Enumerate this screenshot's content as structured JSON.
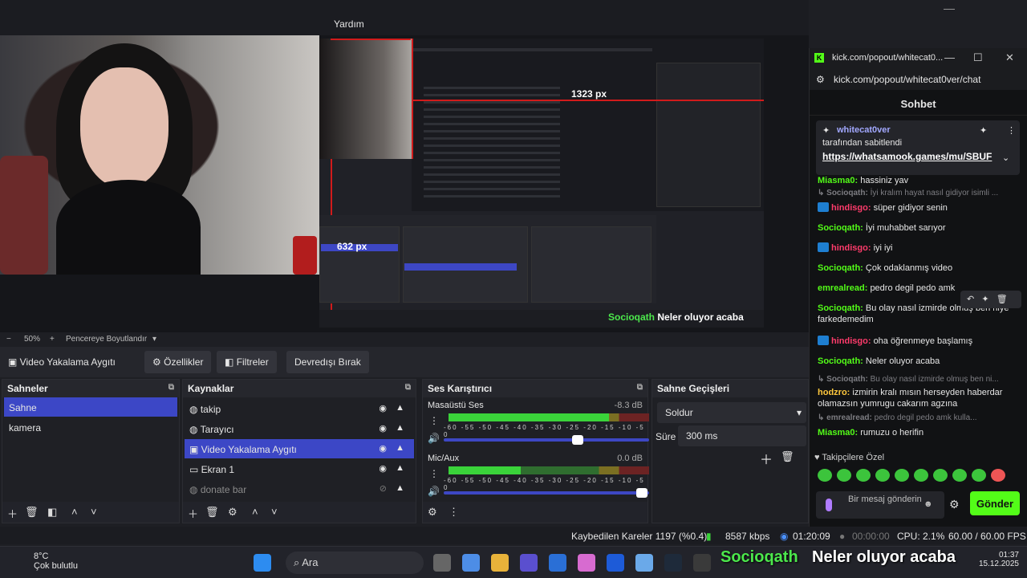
{
  "menubar": {
    "help": "Yardım"
  },
  "mirror": {
    "width_label": "1323 px",
    "height_label": "632 px",
    "overlay_name": "Socioqath",
    "overlay_msg": "Neler oluyor acaba"
  },
  "zoom": {
    "minus": "−",
    "value": "50%",
    "plus": "+",
    "fit_label": "Pencereye Boyutlandır"
  },
  "source_toolbar": {
    "source_name": "Video Yakalama Aygıtı",
    "properties": "Özellikler",
    "filters": "Filtreler",
    "deactivate": "Devredışı Bırak"
  },
  "scenes": {
    "title": "Sahneler",
    "items": [
      "Sahne",
      "kamera"
    ]
  },
  "sources": {
    "title": "Kaynaklar",
    "items": [
      "takip",
      "Tarayıcı",
      "Video Yakalama Aygıtı",
      "Ekran 1",
      "donate bar"
    ]
  },
  "mixer": {
    "title": "Ses Karıştırıcı",
    "channels": [
      {
        "name": "Masaüstü Ses",
        "db": "-8.3 dB",
        "level": 0.8
      },
      {
        "name": "Mic/Aux",
        "db": "0.0 dB",
        "level": 0.36
      }
    ],
    "ticks": "-60 -55 -50 -45 -40 -35 -30 -25 -20 -15 -10 -5 0"
  },
  "transitions": {
    "title": "Sahne Geçişleri",
    "type": "Soldur",
    "duration_label": "Süre",
    "duration_value": "300 ms"
  },
  "status": {
    "dropped": "Kaybedilen Kareler 1197 (%0.4)",
    "bitrate": "8587 kbps",
    "rec_time": "01:20:09",
    "idle_time": "00:00:00",
    "cpu": "CPU: 2.1%",
    "fps": "60.00 / 60.00 FPS"
  },
  "taskbar": {
    "temp": "8°C",
    "weather": "Çok bulutlu",
    "search": "Ara",
    "overlay_name": "Socioqath",
    "overlay_msg": "Neler oluyor acaba",
    "time": "01:37",
    "date": "15.12.2025"
  },
  "chat": {
    "window_title": "kick.com/popout/whitecat0...",
    "url": "kick.com/popout/whitecat0ver/chat",
    "header": "Sohbet",
    "pinned": {
      "user": "whitecat0ver",
      "line": "tarafından sabitlendi",
      "link": "https://whatsamook.games/mu/SBUF"
    },
    "messages": [
      {
        "user": "Miasma0:",
        "text": "hassiniz yav",
        "color": "#53fc18",
        "reply": false
      },
      {
        "user": "↳ Socioqath:",
        "text": "İyi kralım hayat nasıl gidiyor isimli ...",
        "color": "#7d7d82",
        "reply": true
      },
      {
        "user": "hindisgo:",
        "text": "süper gidiyor senin",
        "color": "#ff3b6b",
        "reply": false,
        "badge": true
      },
      {
        "user": "Socioqath:",
        "text": "İyi muhabbet sarıyor",
        "color": "#53fc18",
        "reply": false
      },
      {
        "user": "hindisgo:",
        "text": "iyi iyi",
        "color": "#ff3b6b",
        "reply": false,
        "badge": true
      },
      {
        "user": "Socioqath:",
        "text": "Çok odaklanmış video",
        "color": "#53fc18",
        "reply": false
      },
      {
        "user": "emrealread:",
        "text": "pedro degil pedo amk",
        "color": "#53fc18",
        "reply": false
      },
      {
        "user": "Socioqath:",
        "text": "Bu olay nasıl izmirde olmuş ben niye farkedemedim",
        "color": "#53fc18",
        "reply": false
      },
      {
        "user": "hindisgo:",
        "text": "oha öğrenmeye başlamış",
        "color": "#ff3b6b",
        "reply": false,
        "badge": true
      },
      {
        "user": "Socioqath:",
        "text": "Neler oluyor acaba",
        "color": "#53fc18",
        "reply": false
      },
      {
        "user": "↳ Socioqath:",
        "text": "Bu olay nasıl izmirde olmuş ben ni...",
        "color": "#7d7d82",
        "reply": true
      },
      {
        "user": "hodzro:",
        "text": "izmirin kralı mısın herseyden haberdar olamazsın yumrugu cakarım agzına",
        "color": "#ffc83d",
        "reply": false
      },
      {
        "user": "↳ emrealread:",
        "text": "pedro degil pedo amk kulla...",
        "color": "#7d7d82",
        "reply": true
      },
      {
        "user": "Miasma0:",
        "text": "rumuzu o herifin",
        "color": "#53fc18",
        "reply": false
      }
    ],
    "followers_label": "Takipçilere Özel",
    "input_placeholder": "Bir mesaj gönderin",
    "send": "Gönder"
  }
}
